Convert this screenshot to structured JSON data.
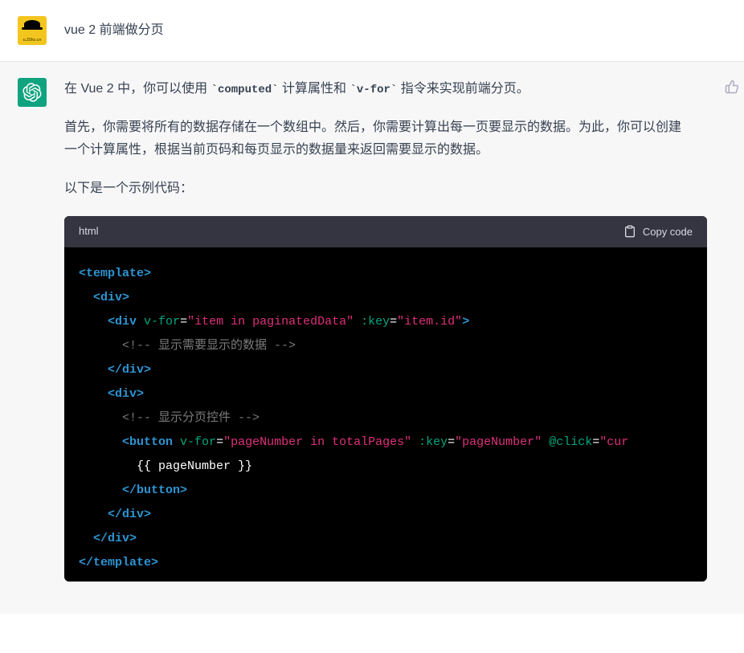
{
  "user": {
    "message": "vue 2 前端做分页"
  },
  "assistant": {
    "p1_pre": "在 Vue 2 中，你可以使用 ",
    "p1_code1": "`computed`",
    "p1_mid": " 计算属性和 ",
    "p1_code2": "`v-for`",
    "p1_post": " 指令来实现前端分页。",
    "p2": "首先，你需要将所有的数据存储在一个数组中。然后，你需要计算出每一页要显示的数据。为此，你可以创建一个计算属性，根据当前页码和每页显示的数据量来返回需要显示的数据。",
    "p3": "以下是一个示例代码：",
    "code_lang": "html",
    "copy_label": "Copy code",
    "code": {
      "l1_tag": "<template>",
      "l2_tag": "<div>",
      "l3_tag_open": "<div",
      "l3_attr1": "v-for",
      "l3_val1": "\"item in paginatedData\"",
      "l3_attr2": ":key",
      "l3_val2": "\"item.id\"",
      "l3_tag_close": ">",
      "l4_comment": "<!-- 显示需要显示的数据 -->",
      "l5_tag": "</div>",
      "l6_tag": "<div>",
      "l7_comment": "<!-- 显示分页控件 -->",
      "l8_tag_open": "<button",
      "l8_attr1": "v-for",
      "l8_val1": "\"pageNumber in totalPages\"",
      "l8_attr2": ":key",
      "l8_val2": "\"pageNumber\"",
      "l8_attr3": "@click",
      "l8_val3": "\"cur",
      "l9_expr": "{{ pageNumber }}",
      "l10_tag": "</button>",
      "l11_tag": "</div>",
      "l12_tag": "</div>",
      "l13_tag": "</template>"
    }
  }
}
